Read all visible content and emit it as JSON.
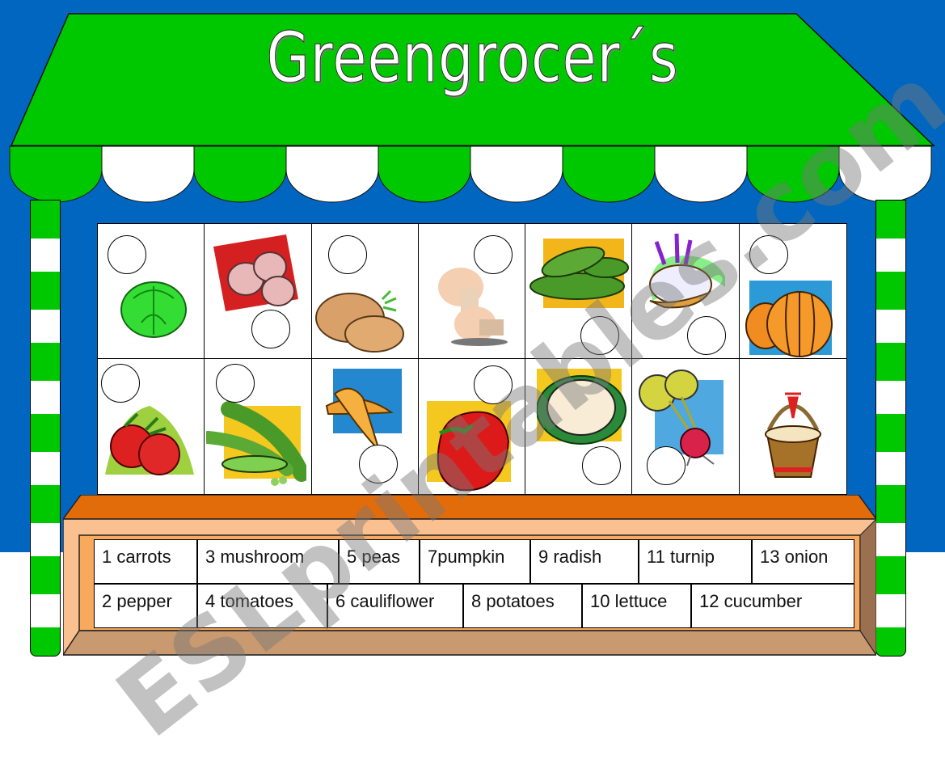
{
  "title": "Greengrocer´s",
  "colors": {
    "sky": "#0066bf",
    "awning_green": "#00c800",
    "awning_white": "#ffffff",
    "counter_top": "#e36c0a",
    "counter_face": "#fac090",
    "counter_base": "#c9996f"
  },
  "grid": {
    "rows": [
      [
        {
          "item": "lettuce",
          "icon": "lettuce-icon"
        },
        {
          "item": "garlic",
          "icon": "garlic-icon"
        },
        {
          "item": "potatoes",
          "icon": "potatoes-icon"
        },
        {
          "item": "mushroom",
          "icon": "mushroom-icon"
        },
        {
          "item": "cucumber",
          "icon": "cucumber-icon"
        },
        {
          "item": "onion",
          "icon": "onion-icon"
        },
        {
          "item": "pumpkin",
          "icon": "pumpkin-icon"
        }
      ],
      [
        {
          "item": "tomatoes",
          "icon": "tomatoes-icon"
        },
        {
          "item": "peas",
          "icon": "peas-icon"
        },
        {
          "item": "carrots",
          "icon": "carrots-icon"
        },
        {
          "item": "pepper",
          "icon": "pepper-icon"
        },
        {
          "item": "cauliflower",
          "icon": "cauliflower-icon"
        },
        {
          "item": "radish",
          "icon": "radish-icon"
        },
        {
          "item": "basket",
          "icon": "basket-icon"
        }
      ]
    ]
  },
  "word_bank": {
    "row1": [
      "1 carrots",
      "3 mushroom",
      "5 peas",
      "7pumpkin",
      "9 radish",
      "11 turnip",
      "13 onion"
    ],
    "row2": [
      "2 pepper",
      "4 tomatoes",
      "6 cauliflower",
      "8 potatoes",
      "10 lettuce",
      "12 cucumber"
    ]
  },
  "watermark": "ESLprintables.com"
}
